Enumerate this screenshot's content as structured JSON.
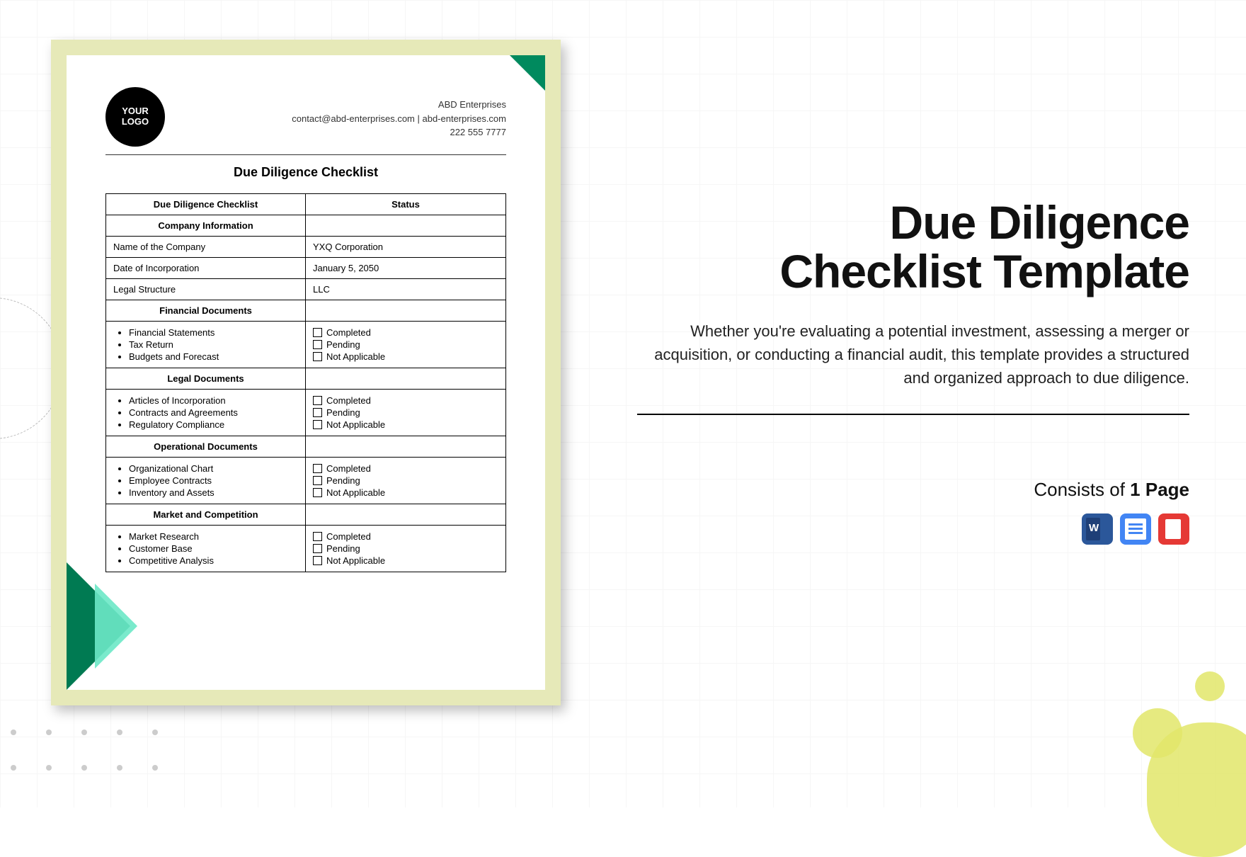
{
  "logo": {
    "line1": "YOUR",
    "line2": "LOGO"
  },
  "header": {
    "company": "ABD Enterprises",
    "contact": "contact@abd-enterprises.com | abd-enterprises.com",
    "phone": "222 555 7777"
  },
  "doc_title": "Due Diligence Checklist",
  "table": {
    "head_left": "Due Diligence Checklist",
    "head_right": "Status",
    "company_info_hdr": "Company Information",
    "rows_info": [
      {
        "label": "Name of the Company",
        "value": "YXQ Corporation"
      },
      {
        "label": "Date of Incorporation",
        "value": "January 5, 2050"
      },
      {
        "label": "Legal Structure",
        "value": "LLC"
      }
    ],
    "sections": [
      {
        "hdr": "Financial Documents",
        "items": [
          "Financial Statements",
          "Tax Return",
          "Budgets and Forecast"
        ],
        "status": [
          "Completed",
          "Pending",
          "Not Applicable"
        ]
      },
      {
        "hdr": "Legal Documents",
        "items": [
          "Articles of Incorporation",
          "Contracts and Agreements",
          "Regulatory Compliance"
        ],
        "status": [
          "Completed",
          "Pending",
          "Not Applicable"
        ]
      },
      {
        "hdr": "Operational Documents",
        "items": [
          "Organizational Chart",
          "Employee Contracts",
          "Inventory and Assets"
        ],
        "status": [
          "Completed",
          "Pending",
          "Not Applicable"
        ]
      },
      {
        "hdr": "Market and Competition",
        "items": [
          "Market Research",
          "Customer Base",
          "Competitive Analysis"
        ],
        "status": [
          "Completed",
          "Pending",
          "Not Applicable"
        ]
      }
    ]
  },
  "right": {
    "title_l1": "Due Diligence",
    "title_l2": "Checklist Template",
    "desc": "Whether you're evaluating a potential investment, assessing a merger or acquisition, or conducting a financial audit, this template provides a structured and organized approach to due diligence.",
    "consists_prefix": "Consists of ",
    "consists_bold": "1 Page"
  }
}
